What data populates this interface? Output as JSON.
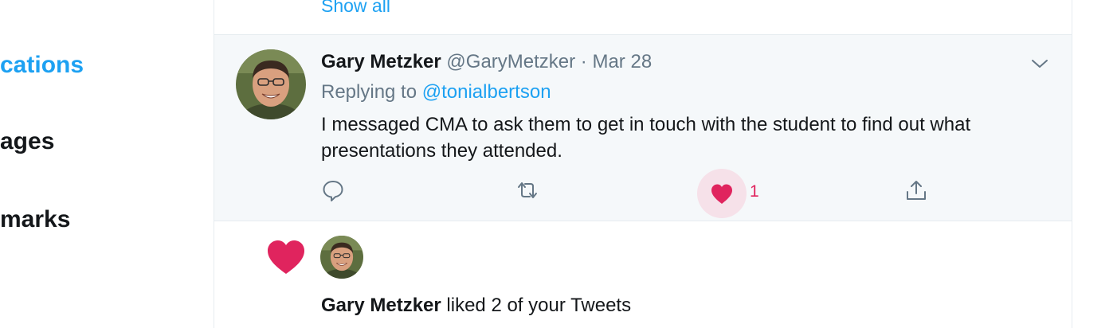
{
  "nav": {
    "notifications_label": "cations",
    "messages_label": "ages",
    "bookmarks_label": "marks"
  },
  "timeline": {
    "show_all_label": "Show all"
  },
  "tweet": {
    "author_name": "Gary Metzker",
    "author_handle": "@GaryMetzker",
    "separator": " · ",
    "date": "Mar 28",
    "replying_prefix": "Replying to ",
    "replying_handle": "@tonialbertson",
    "text": "I messaged CMA to ask them to get in touch with the student to find out what presentations they attended.",
    "like_count": "1",
    "liked": true,
    "icons": [
      "reply-icon",
      "retweet-icon",
      "heart-icon",
      "share-icon",
      "chevron-down-icon"
    ]
  },
  "notification": {
    "actor_name": "Gary Metzker",
    "action_text": " liked 2 of your Tweets",
    "icons": [
      "heart-icon"
    ]
  },
  "colors": {
    "accent": "#1da1f2",
    "like": "#e0245e",
    "muted": "#657786",
    "tweet_bg": "#f5f8fa",
    "border": "#e6ecf0"
  }
}
